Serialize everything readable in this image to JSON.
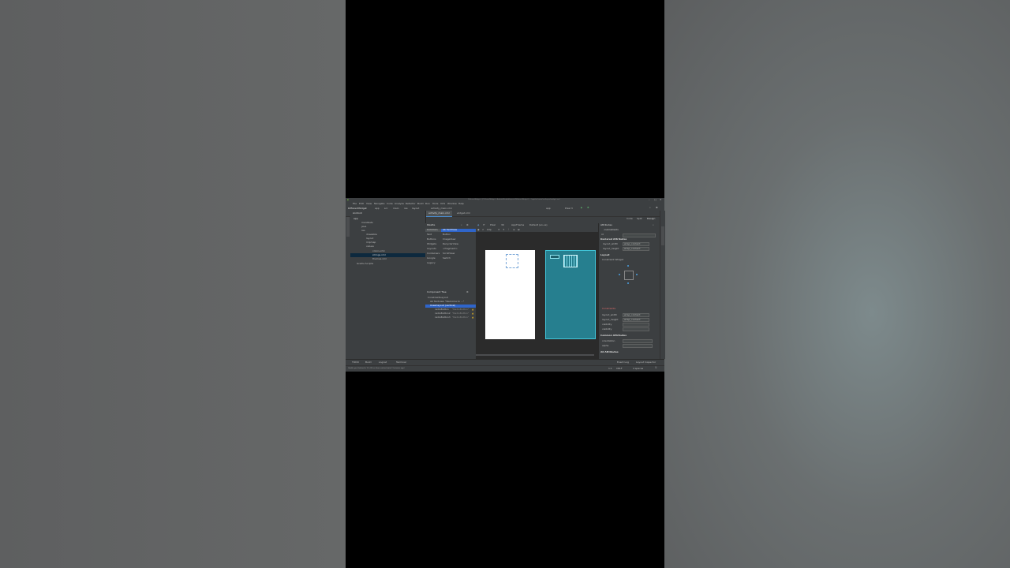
{
  "window": {
    "title": "DifferentWidget - [C:\\Users\\Widget - Android\\StudioProjects\\DifferentWidget] - ...\\app\\src\\main\\res\\layout\\widget.xml",
    "menu": [
      "File",
      "Edit",
      "View",
      "Navigate",
      "Code",
      "Analyze",
      "Refactor",
      "Build",
      "Run",
      "Tools",
      "VCS",
      "Window",
      "Help"
    ]
  },
  "navbar": {
    "crumbs": [
      "DifferentWidget",
      "app",
      "src",
      "main",
      "res",
      "layout",
      "activity_main.xml"
    ],
    "run_config": "app",
    "device": "Pixel 3"
  },
  "tabs": [
    {
      "label": "activity_main.xml",
      "active": true
    },
    {
      "label": "widget.xml",
      "active": false
    }
  ],
  "view_modes": [
    "Code",
    "Split",
    "Design"
  ],
  "project": {
    "selector": "Android",
    "tree": [
      {
        "label": "app",
        "depth": 0
      },
      {
        "label": "manifests",
        "depth": 1
      },
      {
        "label": "java",
        "depth": 1
      },
      {
        "label": "res",
        "depth": 1
      },
      {
        "label": "drawable",
        "depth": 2
      },
      {
        "label": "layout",
        "depth": 2
      },
      {
        "label": "mipmap",
        "depth": 2
      },
      {
        "label": "values",
        "depth": 2
      },
      {
        "label": "colors.xml",
        "depth": 3
      },
      {
        "label": "strings.xml",
        "depth": 3
      },
      {
        "label": "themes.xml",
        "depth": 3
      },
      {
        "label": "Gradle Scripts",
        "depth": 0
      }
    ]
  },
  "palette": {
    "title": "Palette",
    "categories": [
      "Common",
      "Text",
      "Buttons",
      "Widgets",
      "Layouts",
      "Containers",
      "Google",
      "Legacy"
    ],
    "items": [
      "Ab TextView",
      "Button",
      "ImageView",
      "RecyclerView",
      "<fragment>",
      "ScrollView",
      "Switch"
    ]
  },
  "component_tree": {
    "title": "Component Tree",
    "rows": [
      {
        "label": "ConstraintLayout",
        "depth": 0
      },
      {
        "label": "Ab  Textview  \"Welcome to ...\"",
        "depth": 1
      },
      {
        "label": "linearlayout (vertical)",
        "depth": 1,
        "selected": true
      },
      {
        "label": "radioButton",
        "depth": 2,
        "note": "\"RadioButton\""
      },
      {
        "label": "radioButton2",
        "depth": 2,
        "note": "\"RadioButton\""
      },
      {
        "label": "radioButton3",
        "depth": 2,
        "note": "\"RadioButton\""
      }
    ]
  },
  "design_toolbar": {
    "orientation": "Pixel",
    "api": "30",
    "theme": "AppTheme",
    "locale": "Default (en-us)",
    "zoom": "0dp"
  },
  "attributes": {
    "title": "Attributes",
    "component": "<unnamed>",
    "id_label": "id",
    "sections": {
      "declared": "Declared Attributes",
      "layout": "Layout",
      "constraint_widget": "Constraint Widget",
      "constraints": "Constraints",
      "common": "Common Attributes",
      "all": "All Attributes"
    },
    "declared_rows": [
      {
        "name": "layout_width",
        "value": "wrap_content"
      },
      {
        "name": "layout_height",
        "value": "wrap_content"
      }
    ],
    "layout_rows": [
      {
        "name": "layout_width",
        "value": "wrap_content"
      },
      {
        "name": "layout_height",
        "value": "wrap_content"
      },
      {
        "name": "visibility",
        "value": ""
      },
      {
        "name": "visibility",
        "value": ""
      }
    ],
    "common_rows": [
      {
        "name": "orientation",
        "value": ""
      },
      {
        "name": "alpha",
        "value": ""
      }
    ]
  },
  "bottom_tabs": [
    "TODO",
    "Build",
    "Logcat",
    "Terminal"
  ],
  "bottom_right_tabs": [
    "Event Log",
    "Layout Inspector"
  ],
  "status": {
    "message": "Gradle sync finished in 12 s 82 ms (from cached state) (3 minutes ago)",
    "position": "1:1",
    "encoding": "CRLF",
    "spaces": "4 spaces"
  },
  "colors": {
    "ide_bg": "#3c3f41",
    "editor_bg": "#2b2b2b",
    "selection": "#2f65ca",
    "blueprint": "#267f8f",
    "warning": "#e6b422"
  }
}
